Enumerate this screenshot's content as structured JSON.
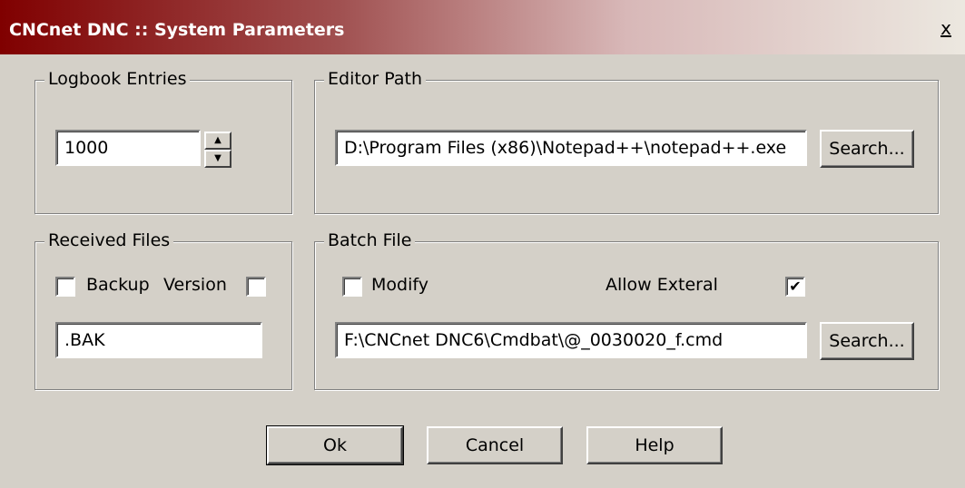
{
  "window": {
    "title": "CNCnet DNC :: System Parameters",
    "close_glyph": "x"
  },
  "logbook": {
    "legend": "Logbook Entries",
    "value": "1000",
    "spin_up": "▲",
    "spin_down": "▼"
  },
  "editor": {
    "legend": "Editor Path",
    "path": "D:\\Program Files (x86)\\Notepad++\\notepad++.exe",
    "search_label": "Search..."
  },
  "received": {
    "legend": "Received Files",
    "backup_label": "Backup",
    "backup_checked": false,
    "version_label": "Version",
    "version_checked": false,
    "extension": ".BAK"
  },
  "batch": {
    "legend": "Batch File",
    "modify_label": "Modify",
    "modify_checked": false,
    "allow_label": "Allow Exteral",
    "allow_checked": true,
    "check_glyph": "✔",
    "path": "F:\\CNCnet DNC6\\Cmdbat\\@_0030020_f.cmd",
    "search_label": "Search..."
  },
  "buttons": {
    "ok": "Ok",
    "cancel": "Cancel",
    "help": "Help"
  }
}
